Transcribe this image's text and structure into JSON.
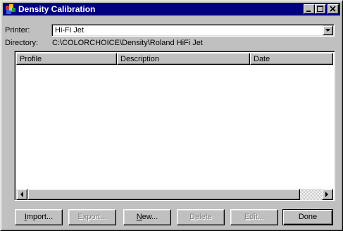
{
  "window": {
    "title": "Density Calibration",
    "title_bar_color": "#000080",
    "icon": "app-palette-icon",
    "controls": [
      "minimize-icon",
      "maximize-icon",
      "close-icon"
    ]
  },
  "printer": {
    "label": "Printer:",
    "value": "Hi-Fi Jet"
  },
  "directory": {
    "label": "Directory:",
    "value": "C:\\COLORCHOICE\\Density\\Roland HiFi Jet"
  },
  "list": {
    "columns": [
      "Profile",
      "Description",
      "Date"
    ],
    "rows": []
  },
  "buttons": {
    "import": {
      "pre": "",
      "accel": "I",
      "post": "mport...",
      "enabled": true
    },
    "export": {
      "pre": "E",
      "accel": "x",
      "post": "port...",
      "enabled": false
    },
    "new": {
      "pre": "",
      "accel": "N",
      "post": "ew...",
      "enabled": true
    },
    "delete": {
      "pre": "",
      "accel": "D",
      "post": "elete",
      "enabled": false
    },
    "edit": {
      "pre": "",
      "accel": "E",
      "post": "dit...",
      "enabled": false
    },
    "done": {
      "label": "Done",
      "enabled": true
    }
  }
}
